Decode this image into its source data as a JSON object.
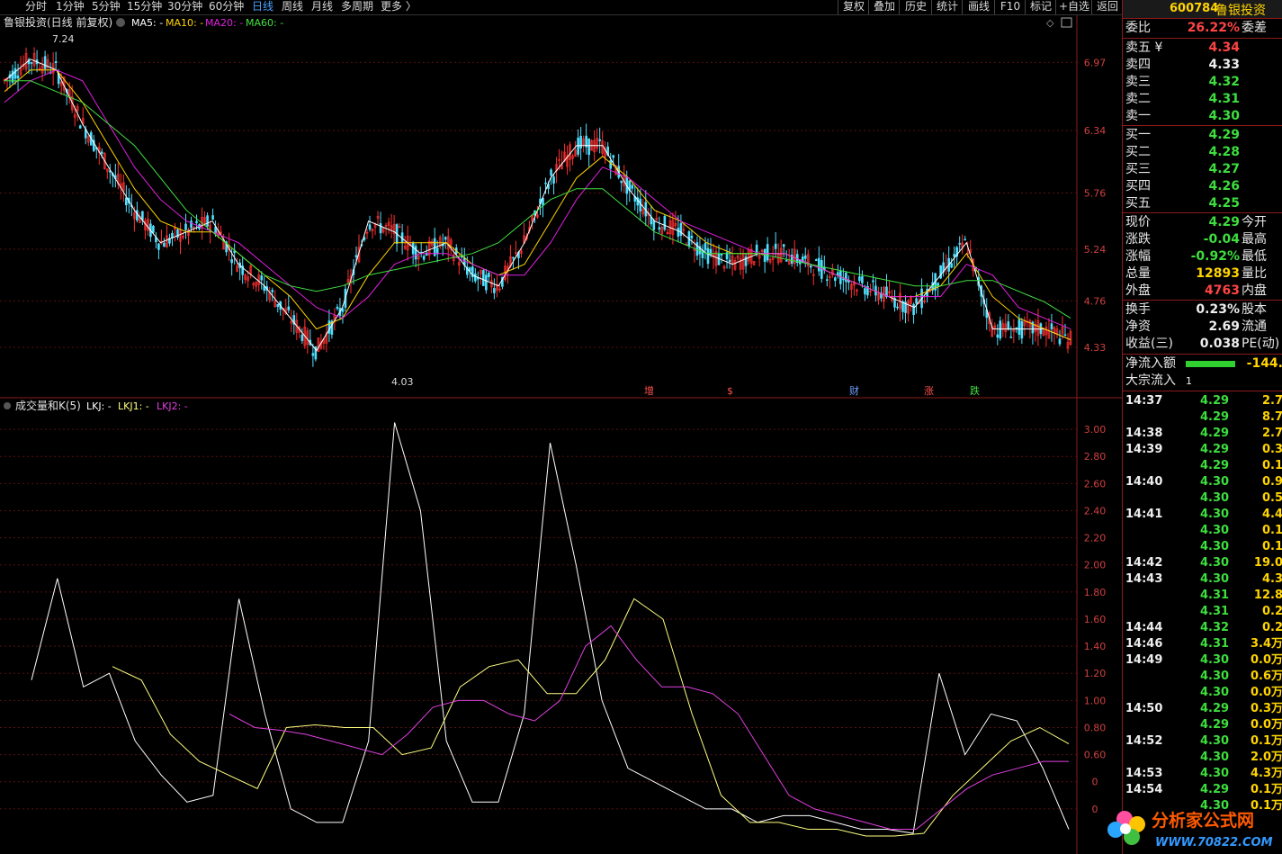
{
  "toolbar": {
    "left": [
      "分时",
      "1分钟",
      "5分钟",
      "15分钟",
      "30分钟",
      "60分钟",
      "日线",
      "周线",
      "月线",
      "多周期",
      "更多 〉"
    ],
    "active": "日线",
    "right": [
      "复权",
      "叠加",
      "历史",
      "统计",
      "画线",
      "F10",
      "标记",
      "+自选",
      "返回"
    ]
  },
  "main": {
    "title": "鲁银投资(日线 前复权)",
    "ma_labels": [
      {
        "text": "MA5: -",
        "color": "#ffffff"
      },
      {
        "text": "MA10: -",
        "color": "#ffd400"
      },
      {
        "text": "MA20: -",
        "color": "#e020e0"
      },
      {
        "text": "MA60: -",
        "color": "#40e040"
      }
    ],
    "y_ticks": [
      "6.97",
      "6.34",
      "5.76",
      "5.24",
      "4.76",
      "4.33"
    ],
    "high_label": "7.24",
    "low_label": "4.03",
    "markers": [
      {
        "text": "增",
        "color": "#ff5050"
      },
      {
        "text": "$",
        "color": "#ff5050"
      },
      {
        "text": "财",
        "color": "#6fa0ff"
      },
      {
        "text": "涨",
        "color": "#ff5050"
      },
      {
        "text": "跌",
        "color": "#40e040"
      }
    ]
  },
  "sub": {
    "title": "成交量和K(5)",
    "labels": [
      {
        "text": "LKJ: -",
        "color": "#ffffff"
      },
      {
        "text": "LKJ1: -",
        "color": "#ffff80"
      },
      {
        "text": "LKJ2: -",
        "color": "#e040e0"
      }
    ],
    "y_ticks": [
      "3.00",
      "2.80",
      "2.60",
      "2.40",
      "2.20",
      "2.00",
      "1.80",
      "1.60",
      "1.40",
      "1.20",
      "1.00",
      "0.80",
      "0.60",
      "0",
      "0"
    ]
  },
  "chart_data": [
    {
      "type": "line",
      "title": "鲁银投资(日线 前复权)",
      "ylim": [
        4.03,
        7.24
      ],
      "series": [
        {
          "name": "MA5",
          "values": [
            6.8,
            7.0,
            6.9,
            6.4,
            6.0,
            5.6,
            5.3,
            5.4,
            5.5,
            5.1,
            4.9,
            4.6,
            4.3,
            4.7,
            5.5,
            5.4,
            5.2,
            5.3,
            5.0,
            4.9,
            5.3,
            5.9,
            6.2,
            6.2,
            5.8,
            5.5,
            5.4,
            5.2,
            5.1,
            5.2,
            5.2,
            5.1,
            5.0,
            4.9,
            4.8,
            4.7,
            5.0,
            5.3,
            4.5,
            4.5,
            4.5,
            4.4
          ]
        },
        {
          "name": "MA10",
          "values": [
            6.7,
            6.9,
            6.9,
            6.6,
            6.2,
            5.8,
            5.5,
            5.4,
            5.4,
            5.2,
            5.0,
            4.8,
            4.5,
            4.6,
            5.0,
            5.3,
            5.3,
            5.3,
            5.1,
            5.0,
            5.1,
            5.5,
            5.9,
            6.1,
            5.9,
            5.6,
            5.5,
            5.3,
            5.2,
            5.2,
            5.2,
            5.1,
            5.0,
            4.9,
            4.8,
            4.8,
            4.9,
            5.2,
            4.8,
            4.6,
            4.5,
            4.4
          ]
        },
        {
          "name": "MA20",
          "values": [
            6.6,
            6.8,
            6.9,
            6.8,
            6.4,
            6.0,
            5.7,
            5.5,
            5.4,
            5.3,
            5.1,
            4.9,
            4.7,
            4.6,
            4.8,
            5.1,
            5.2,
            5.2,
            5.1,
            5.0,
            5.0,
            5.3,
            5.7,
            6.0,
            5.9,
            5.7,
            5.5,
            5.4,
            5.3,
            5.2,
            5.2,
            5.1,
            5.0,
            4.9,
            4.8,
            4.8,
            4.8,
            5.1,
            5.0,
            4.7,
            4.6,
            4.5
          ]
        },
        {
          "name": "MA60",
          "values": [
            6.8,
            6.8,
            6.7,
            6.6,
            6.4,
            6.2,
            5.9,
            5.6,
            5.4,
            5.2,
            5.0,
            4.9,
            4.85,
            4.9,
            5.0,
            5.05,
            5.1,
            5.15,
            5.2,
            5.3,
            5.5,
            5.7,
            5.8,
            5.8,
            5.6,
            5.4,
            5.3,
            5.2,
            5.2,
            5.2,
            5.15,
            5.1,
            5.05,
            5.0,
            4.95,
            4.9,
            4.9,
            4.95,
            4.95,
            4.85,
            4.75,
            4.6
          ]
        }
      ]
    },
    {
      "type": "line",
      "title": "成交量和K(5)",
      "ylim": [
        0,
        3.1
      ],
      "series": [
        {
          "name": "LKJ",
          "values": [
            1.15,
            1.9,
            1.1,
            1.2,
            0.7,
            0.45,
            0.25,
            0.3,
            1.75,
            0.9,
            0.2,
            0.1,
            0.1,
            0.7,
            3.05,
            2.4,
            0.7,
            0.25,
            0.25,
            0.9,
            2.9,
            2.0,
            1.0,
            0.5,
            0.4,
            0.3,
            0.2,
            0.2,
            0.1,
            0.15,
            0.15,
            0.1,
            0.05,
            0.05,
            0.02,
            1.2,
            0.6,
            0.9,
            0.85,
            0.5,
            0.05
          ]
        },
        {
          "name": "LKJ1",
          "values": [
            1.25,
            1.15,
            0.75,
            0.55,
            0.45,
            0.35,
            0.8,
            0.82,
            0.8,
            0.8,
            0.6,
            0.65,
            1.1,
            1.25,
            1.3,
            1.05,
            1.05,
            1.3,
            1.75,
            1.6,
            0.9,
            0.3,
            0.1,
            0.1,
            0.05,
            0.05,
            0.0,
            0.0,
            0.02,
            0.3,
            0.5,
            0.7,
            0.8,
            0.68
          ]
        },
        {
          "name": "LKJ2",
          "values": [
            0.9,
            0.8,
            0.78,
            0.75,
            0.7,
            0.65,
            0.6,
            0.75,
            0.95,
            1.0,
            1.0,
            0.9,
            0.85,
            1.0,
            1.4,
            1.55,
            1.3,
            1.1,
            1.1,
            1.05,
            0.9,
            0.6,
            0.3,
            0.2,
            0.15,
            0.1,
            0.05,
            0.05,
            0.2,
            0.35,
            0.45,
            0.5,
            0.55,
            0.55
          ]
        }
      ]
    }
  ],
  "right_panel": {
    "code": "600784",
    "name": "鲁银投资",
    "ratio_label": "委比",
    "ratio_value": "26.22%",
    "ratio_diff_label": "委差",
    "asks": [
      {
        "label": "卖五 ¥",
        "price": "4.34",
        "color": "#ff4444"
      },
      {
        "label": "卖四",
        "price": "4.33",
        "color": "#eeeeee"
      },
      {
        "label": "卖三",
        "price": "4.32",
        "color": "#3dde3d"
      },
      {
        "label": "卖二",
        "price": "4.31",
        "color": "#3dde3d"
      },
      {
        "label": "卖一",
        "price": "4.30",
        "color": "#3dde3d"
      }
    ],
    "bids": [
      {
        "label": "买一",
        "price": "4.29",
        "color": "#3dde3d"
      },
      {
        "label": "买二",
        "price": "4.28",
        "color": "#3dde3d"
      },
      {
        "label": "买三",
        "price": "4.27",
        "color": "#3dde3d"
      },
      {
        "label": "买四",
        "price": "4.26",
        "color": "#3dde3d"
      },
      {
        "label": "买五",
        "price": "4.25",
        "color": "#3dde3d"
      }
    ],
    "quote": [
      {
        "label": "现价",
        "value": "4.29",
        "color": "#3dde3d",
        "label2": "今开"
      },
      {
        "label": "涨跌",
        "value": "-0.04",
        "color": "#3dde3d",
        "label2": "最高"
      },
      {
        "label": "涨幅",
        "value": "-0.92%",
        "color": "#3dde3d",
        "label2": "最低"
      },
      {
        "label": "总量",
        "value": "12893",
        "color": "#ffd400",
        "label2": "量比"
      },
      {
        "label": "外盘",
        "value": "4763",
        "color": "#ff4444",
        "label2": "内盘"
      }
    ],
    "fund": [
      {
        "label": "换手",
        "value": "0.23%",
        "label2": "股本"
      },
      {
        "label": "净资",
        "value": "2.69",
        "label2": "流通"
      },
      {
        "label": "收益(三)",
        "value": "0.038",
        "label2": "PE(动)"
      }
    ],
    "netflow_label": "净流入额",
    "netflow_value": "-144.",
    "netflow_level": 0.55,
    "block_label": "大宗流入",
    "block_value": "1",
    "ticks": [
      {
        "time": "14:37",
        "price": "4.29",
        "vol": "2.7"
      },
      {
        "time": "",
        "price": "4.29",
        "vol": "8.7"
      },
      {
        "time": "14:38",
        "price": "4.29",
        "vol": "2.7"
      },
      {
        "time": "14:39",
        "price": "4.29",
        "vol": "0.3"
      },
      {
        "time": "",
        "price": "4.29",
        "vol": "0.1"
      },
      {
        "time": "14:40",
        "price": "4.30",
        "vol": "0.9"
      },
      {
        "time": "",
        "price": "4.30",
        "vol": "0.5"
      },
      {
        "time": "14:41",
        "price": "4.30",
        "vol": "4.4"
      },
      {
        "time": "",
        "price": "4.30",
        "vol": "0.1"
      },
      {
        "time": "",
        "price": "4.30",
        "vol": "0.1"
      },
      {
        "time": "14:42",
        "price": "4.30",
        "vol": "19.0"
      },
      {
        "time": "14:43",
        "price": "4.30",
        "vol": "4.3"
      },
      {
        "time": "",
        "price": "4.31",
        "vol": "12.8"
      },
      {
        "time": "",
        "price": "4.31",
        "vol": "0.2"
      },
      {
        "time": "14:44",
        "price": "4.32",
        "vol": "0.2"
      },
      {
        "time": "14:46",
        "price": "4.31",
        "vol": "3.4万"
      },
      {
        "time": "14:49",
        "price": "4.30",
        "vol": "0.0万"
      },
      {
        "time": "",
        "price": "4.30",
        "vol": "0.6万"
      },
      {
        "time": "",
        "price": "4.30",
        "vol": "0.0万"
      },
      {
        "time": "14:50",
        "price": "4.29",
        "vol": "0.3万"
      },
      {
        "time": "",
        "price": "4.29",
        "vol": "0.0万"
      },
      {
        "time": "14:52",
        "price": "4.30",
        "vol": "0.1万"
      },
      {
        "time": "",
        "price": "4.30",
        "vol": "2.0万"
      },
      {
        "time": "14:53",
        "price": "4.30",
        "vol": "4.3万"
      },
      {
        "time": "14:54",
        "price": "4.29",
        "vol": "0.1万"
      },
      {
        "time": "",
        "price": "4.30",
        "vol": "0.1万"
      }
    ]
  },
  "watermark": {
    "text": "分析家公式网",
    "url": "WWW.70822.COM"
  }
}
